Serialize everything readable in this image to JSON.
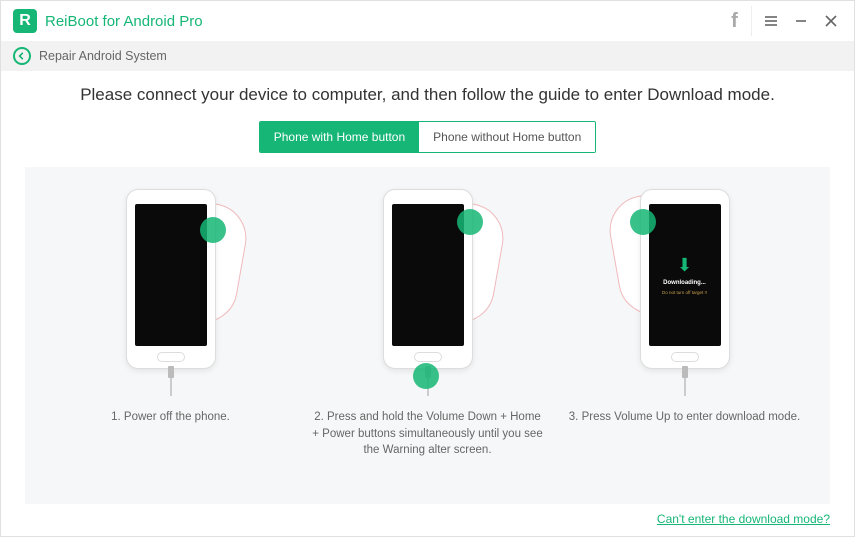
{
  "app": {
    "title": "ReiBoot for Android Pro",
    "logo_letter": "R"
  },
  "breadcrumb": {
    "text": "Repair Android System"
  },
  "main": {
    "heading": "Please connect your device to computer, and then follow the guide to enter Download mode.",
    "tabs": {
      "with_home": "Phone with Home button",
      "without_home": "Phone without Home button"
    },
    "steps": {
      "s1": "1. Power off the phone.",
      "s2": "2. Press and hold the Volume Down + Home + Power buttons simultaneously until you see the Warning alter screen.",
      "s3": "3. Press Volume Up to enter download mode."
    },
    "download_screen": {
      "title": "Downloading...",
      "warn": "Do not turn off target !!"
    },
    "footer_link": "Can't enter the download mode?"
  }
}
